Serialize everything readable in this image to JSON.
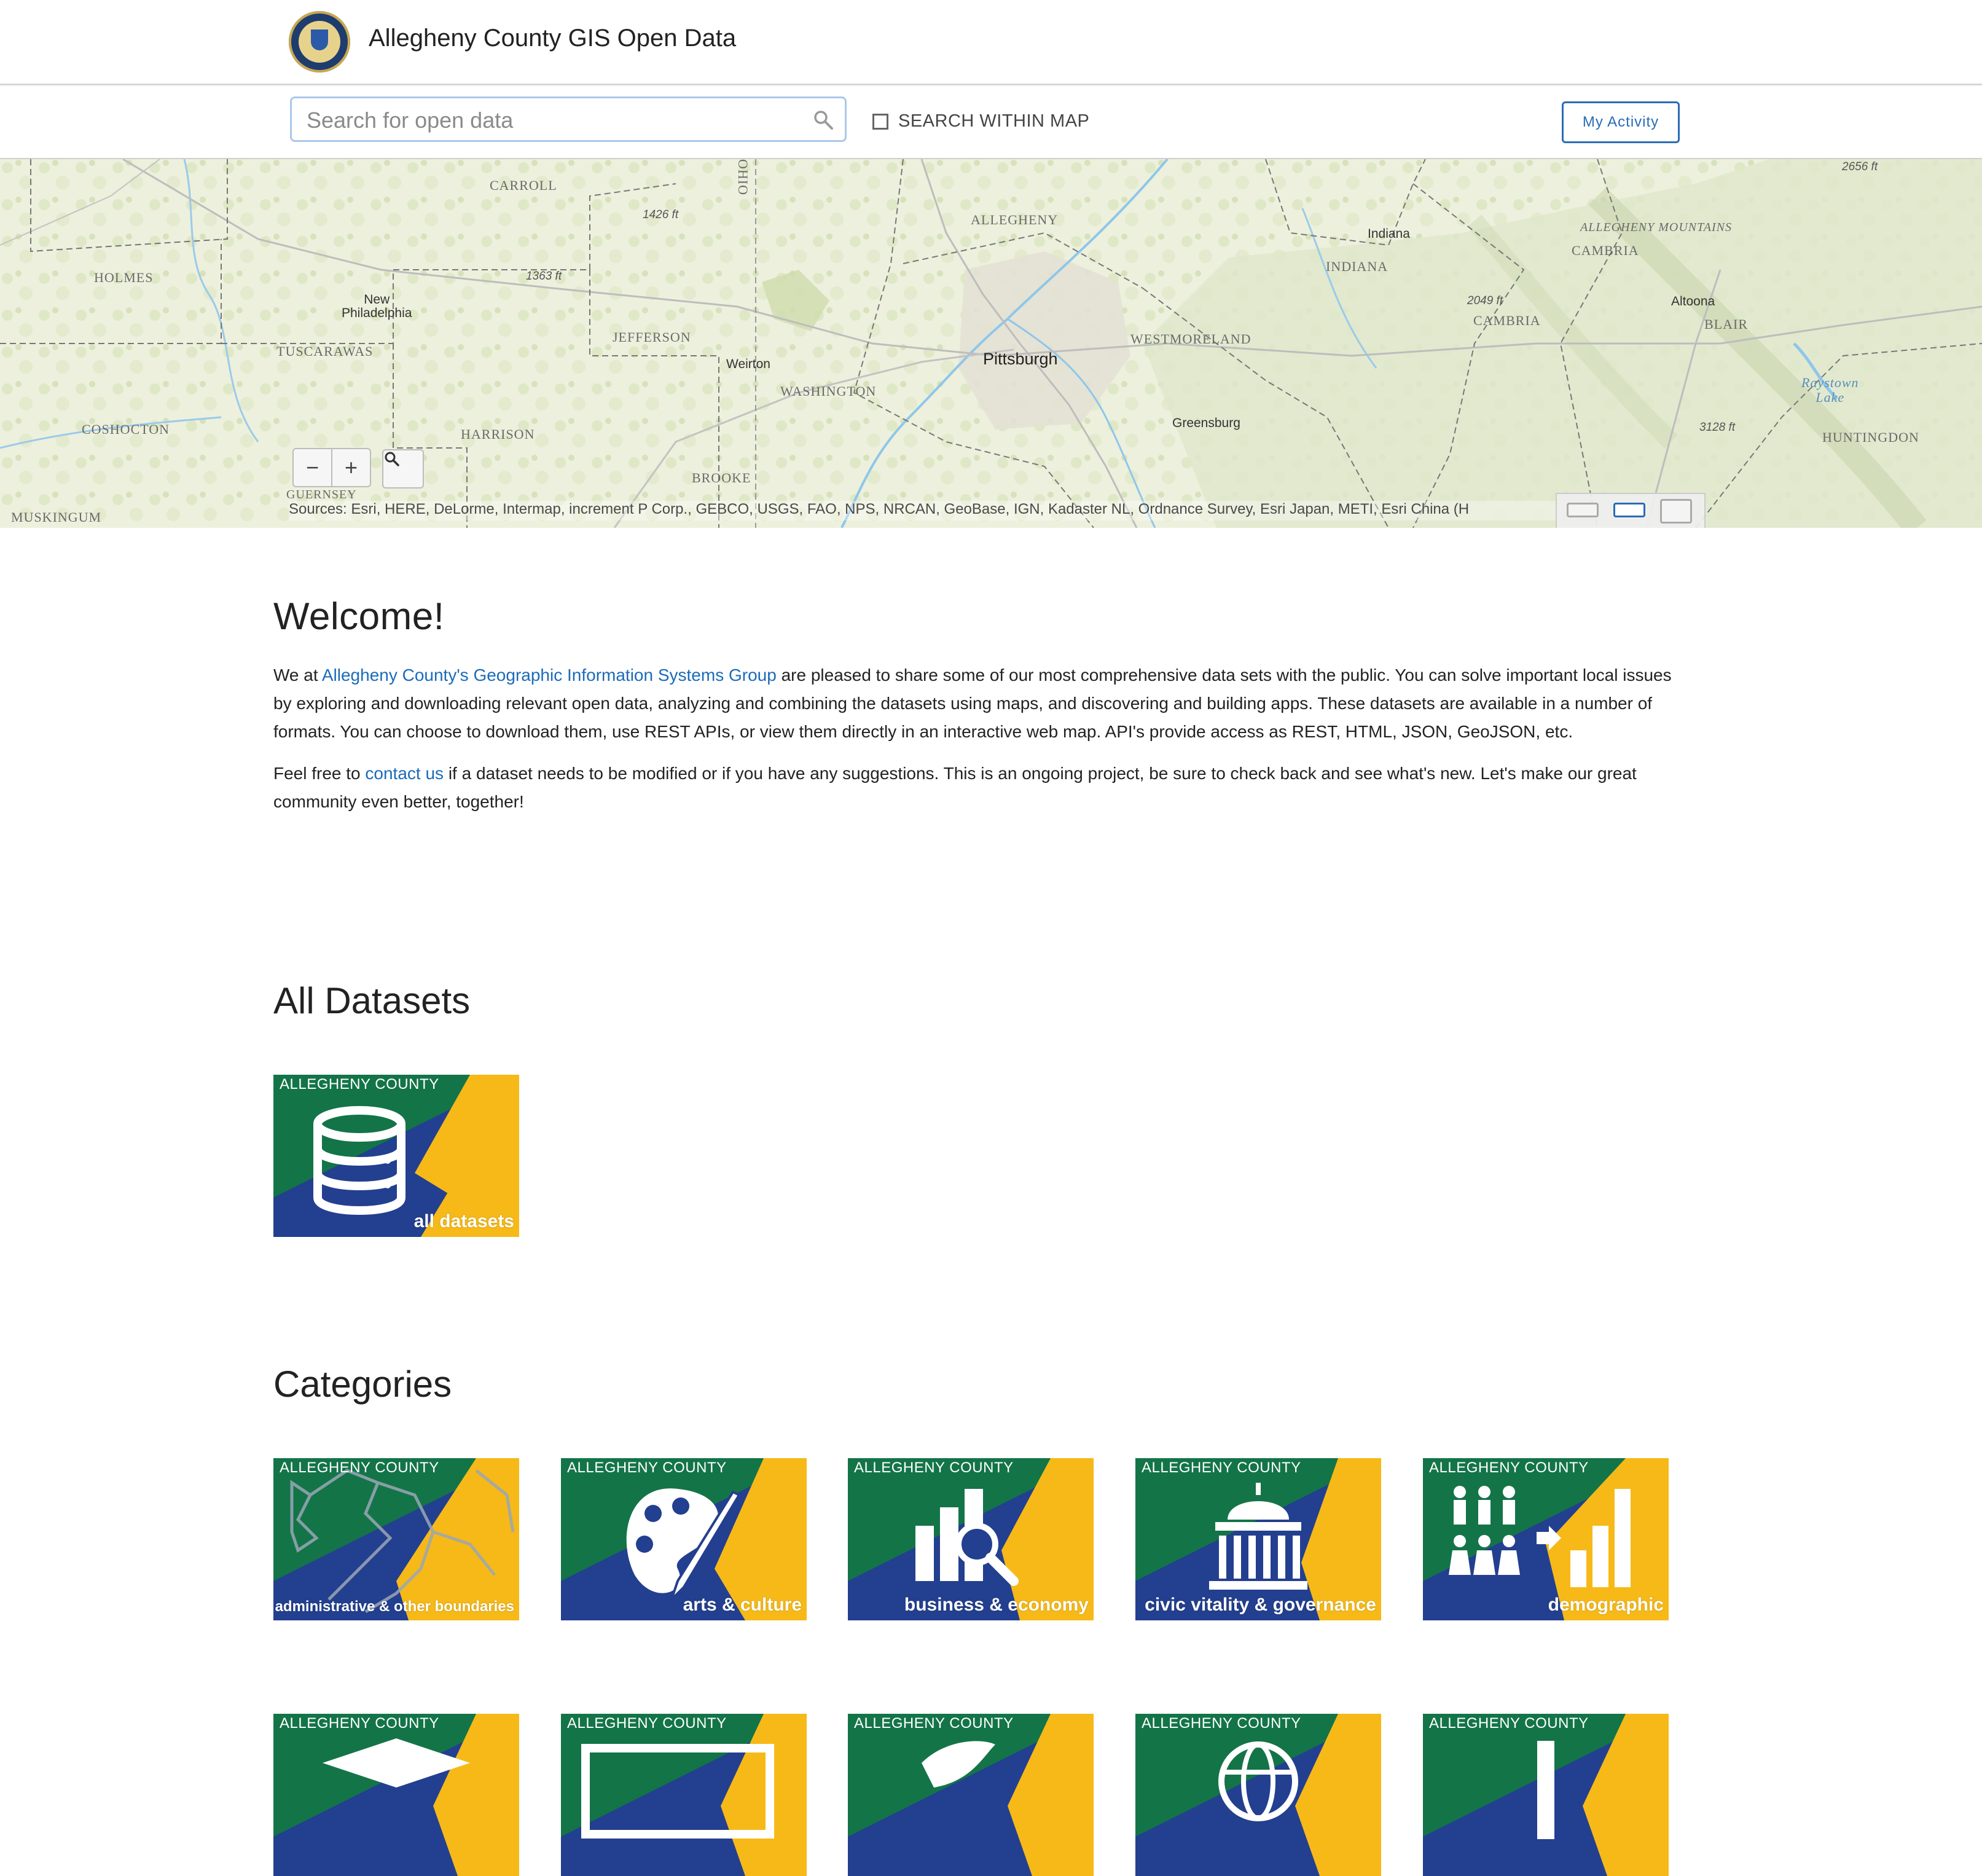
{
  "header": {
    "site_title": "Allegheny County GIS Open Data",
    "logo_icon": "county-seal-icon"
  },
  "search": {
    "placeholder": "Search for open data",
    "value": "",
    "search_within_map_label": "SEARCH WITHIN MAP",
    "search_within_map_checked": false,
    "my_activity_label": "My Activity"
  },
  "map": {
    "labels": {
      "holmes": "HOLMES",
      "carroll": "CARROLL",
      "new_philadelphia": "New\nPhiladelphia",
      "tuscarawas": "TUSCARAWAS",
      "jefferson": "JEFFERSON",
      "coshocton": "COSHOCTON",
      "harrison": "HARRISON",
      "guernsey": "GUERNSEY",
      "muskingum": "MUSKINGUM",
      "brooke": "BROOKE",
      "weirton": "Weirton",
      "washington": "WASHINGTON",
      "allegheny": "ALLEGHENY",
      "pittsburgh": "Pittsburgh",
      "westmoreland": "WESTMORELAND",
      "greensburg": "Greensburg",
      "indiana_city": "Indiana",
      "indiana_county": "INDIANA",
      "cambria": "CAMBRIA",
      "cambria2": "CAMBRIA",
      "allegheny_mountains": "ALLEGHENY MOUNTAINS",
      "altoona": "Altoona",
      "blair": "BLAIR",
      "raystown_lake": "Raystown\nLake",
      "huntingdon": "HUNTINGDON",
      "ohio": "OHIO",
      "elev_1426": "1426 ft",
      "elev_1363": "1363 ft",
      "elev_2049": "2049 ft",
      "elev_3128": "3128 ft",
      "elev_2656": "2656 ft"
    },
    "zoom_out": "−",
    "zoom_in": "+",
    "attribution": "Sources: Esri, HERE, DeLorme, Intermap, increment P Corp., GEBCO, USGS, FAO, NPS, NRCAN, GeoBase, IGN, Kadaster NL, Ordnance Survey, Esri Japan, METI, Esri China (H"
  },
  "welcome": {
    "title": "Welcome!",
    "p1_before": "We at ",
    "p1_link": "Allegheny County's Geographic Information Systems Group",
    "p1_after": " are pleased to share some of our most comprehensive data sets with the public. You can solve important local issues by exploring and downloading relevant open data, analyzing and combining the datasets using maps, and discovering and building apps. These datasets are available in a number of formats. You can choose to download them, use REST APIs, or view them directly in an interactive web map. API's provide access as REST, HTML, JSON, GeoJSON, etc.",
    "p2_before": "Feel free to ",
    "p2_link": "contact us",
    "p2_after": " if a dataset needs to be modified or if you have any suggestions. This is an ongoing project, be sure to check back and see what's new. Let's make our great community even better, together!"
  },
  "all_datasets": {
    "title": "All Datasets",
    "tile": {
      "brand": "ALLEGHENY COUNTY",
      "name": "all datasets",
      "icon": "database-icon"
    }
  },
  "categories": {
    "title": "Categories",
    "row1": [
      {
        "brand": "ALLEGHENY COUNTY",
        "name": "administrative & other boundaries",
        "icon": "boundaries-map-icon"
      },
      {
        "brand": "ALLEGHENY COUNTY",
        "name": "arts & culture",
        "icon": "palette-icon"
      },
      {
        "brand": "ALLEGHENY COUNTY",
        "name": "business & economy",
        "icon": "chart-magnifier-icon"
      },
      {
        "brand": "ALLEGHENY COUNTY",
        "name": "civic vitality & governance",
        "icon": "capitol-icon"
      },
      {
        "brand": "ALLEGHENY COUNTY",
        "name": "demographic",
        "icon": "people-chart-icon"
      }
    ],
    "row2": [
      {
        "brand": "ALLEGHENY COUNTY",
        "name": "",
        "icon": "graduation-cap-icon"
      },
      {
        "brand": "ALLEGHENY COUNTY",
        "name": "",
        "icon": "monitor-icon"
      },
      {
        "brand": "ALLEGHENY COUNTY",
        "name": "",
        "icon": "leaf-icon"
      },
      {
        "brand": "ALLEGHENY COUNTY",
        "name": "",
        "icon": "globe-icon"
      },
      {
        "brand": "ALLEGHENY COUNTY",
        "name": "",
        "icon": "bar-icon"
      }
    ]
  },
  "colors": {
    "tile_green": "#137448",
    "tile_blue": "#233f8f",
    "tile_yellow": "#f6b918",
    "link": "#1b6bb8"
  }
}
